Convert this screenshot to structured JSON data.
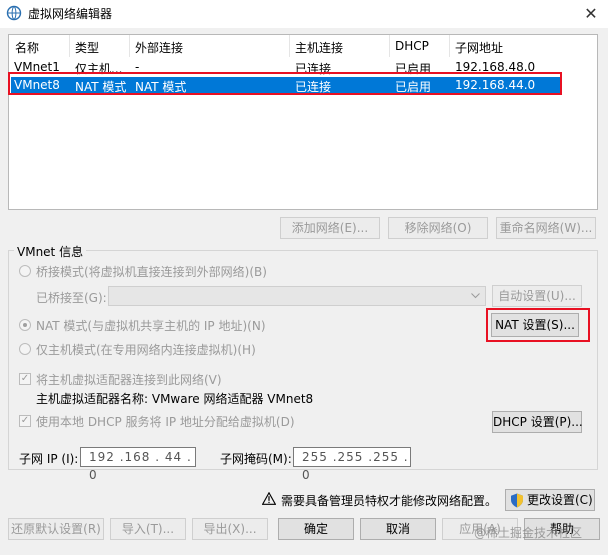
{
  "window": {
    "title": "虚拟网络编辑器",
    "close_glyph": "✕"
  },
  "table": {
    "headers": [
      "名称",
      "类型",
      "外部连接",
      "主机连接",
      "DHCP",
      "子网地址"
    ],
    "rows": [
      [
        "VMnet1",
        "仅主机...",
        "-",
        "已连接",
        "已启用",
        "192.168.48.0"
      ],
      [
        "VMnet8",
        "NAT 模式",
        "NAT 模式",
        "已连接",
        "已启用",
        "192.168.44.0"
      ]
    ],
    "selected_row": 1
  },
  "network_buttons": {
    "add": "添加网络(E)...",
    "remove": "移除网络(O)",
    "rename": "重命名网络(W)..."
  },
  "vmnet_info": {
    "title": "VMnet 信息",
    "bridged_label": "桥接模式(将虚拟机直接连接到外部网络)(B)",
    "bridged_to_label": "已桥接至(G):",
    "bridged_to_value": "",
    "auto_settings": "自动设置(U)...",
    "nat_label": "NAT 模式(与虚拟机共享主机的 IP 地址)(N)",
    "nat_settings": "NAT 设置(S)...",
    "hostonly_label": "仅主机模式(在专用网络内连接虚拟机)(H)",
    "connect_adapter_label": "将主机虚拟适配器连接到此网络(V)",
    "adapter_name_label": "主机虚拟适配器名称: VMware 网络适配器 VMnet8",
    "dhcp_label": "使用本地 DHCP 服务将 IP 地址分配给虚拟机(D)",
    "dhcp_settings": "DHCP 设置(P)...",
    "subnet_ip_label": "子网 IP (I):",
    "subnet_ip_value": "192 .168 . 44 . 0",
    "subnet_mask_label": "子网掩码(M):",
    "subnet_mask_value": "255 .255 .255 . 0"
  },
  "admin_notice": "需要具备管理员特权才能修改网络配置。",
  "change_settings": "更改设置(C)",
  "footer_buttons": {
    "restore": "还原默认设置(R)",
    "import": "导入(T)...",
    "export": "导出(X)...",
    "ok": "确定",
    "cancel": "取消",
    "apply": "应用(A)",
    "help": "帮助"
  },
  "watermark": "@稀土掘金技术社区",
  "colors": {
    "selection": "#0078d7",
    "highlight": "#e81123",
    "dialog_bg": "#f0f0f0"
  },
  "icons": [
    "network-icon",
    "close-icon",
    "warning-icon",
    "shield-icon",
    "dropdown-arrow-icon",
    "checkbox-check-icon"
  ]
}
